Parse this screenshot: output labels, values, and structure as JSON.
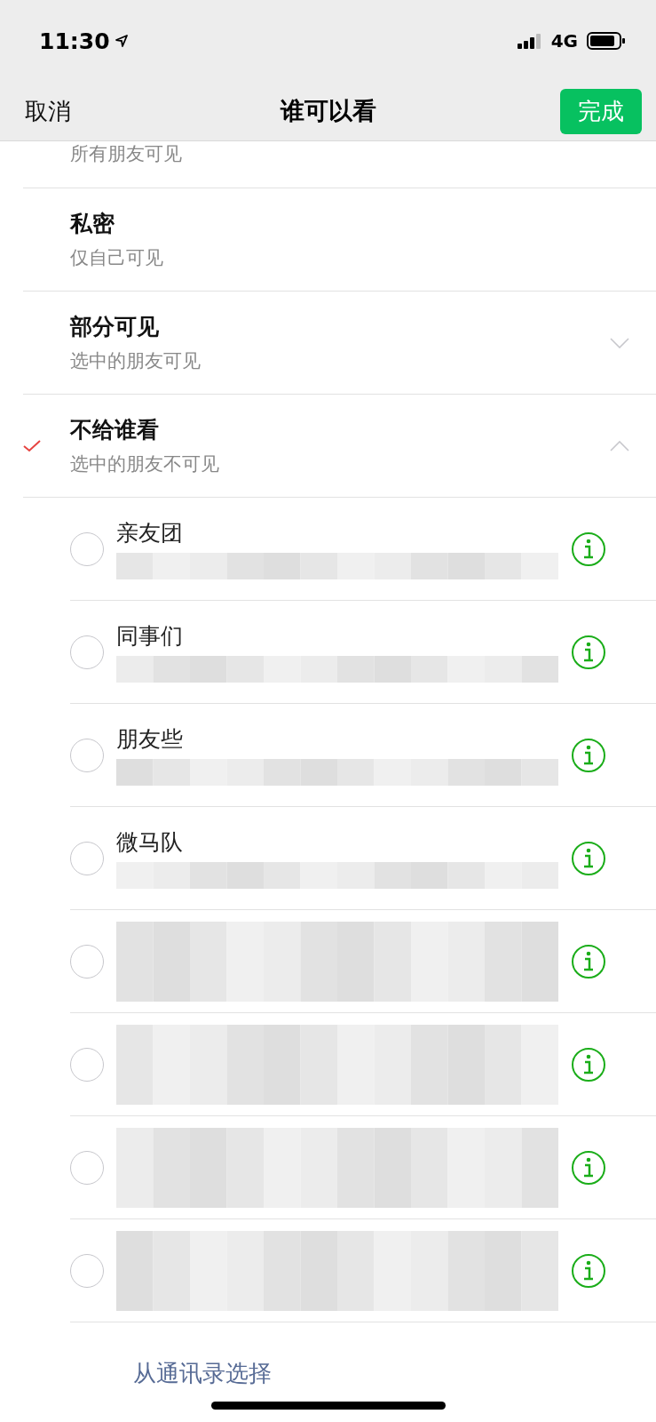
{
  "status_bar": {
    "time": "11:30",
    "network": "4G"
  },
  "nav": {
    "cancel": "取消",
    "title": "谁可以看",
    "done": "完成"
  },
  "options": [
    {
      "subtitle": "所有朋友可见",
      "checked": false
    },
    {
      "title": "私密",
      "subtitle": "仅自己可见",
      "checked": false
    },
    {
      "title": "部分可见",
      "subtitle": "选中的朋友可见",
      "checked": false,
      "expanded": false
    },
    {
      "title": "不给谁看",
      "subtitle": "选中的朋友不可见",
      "checked": true,
      "expanded": true
    }
  ],
  "groups": [
    {
      "name": "亲友团",
      "selected": false
    },
    {
      "name": "同事们",
      "selected": false
    },
    {
      "name": "朋友些",
      "selected": false
    },
    {
      "name": "微马队",
      "selected": false
    },
    {
      "selected": false
    },
    {
      "selected": false
    },
    {
      "selected": false
    },
    {
      "selected": false
    }
  ],
  "footer_link": "从通讯录选择"
}
